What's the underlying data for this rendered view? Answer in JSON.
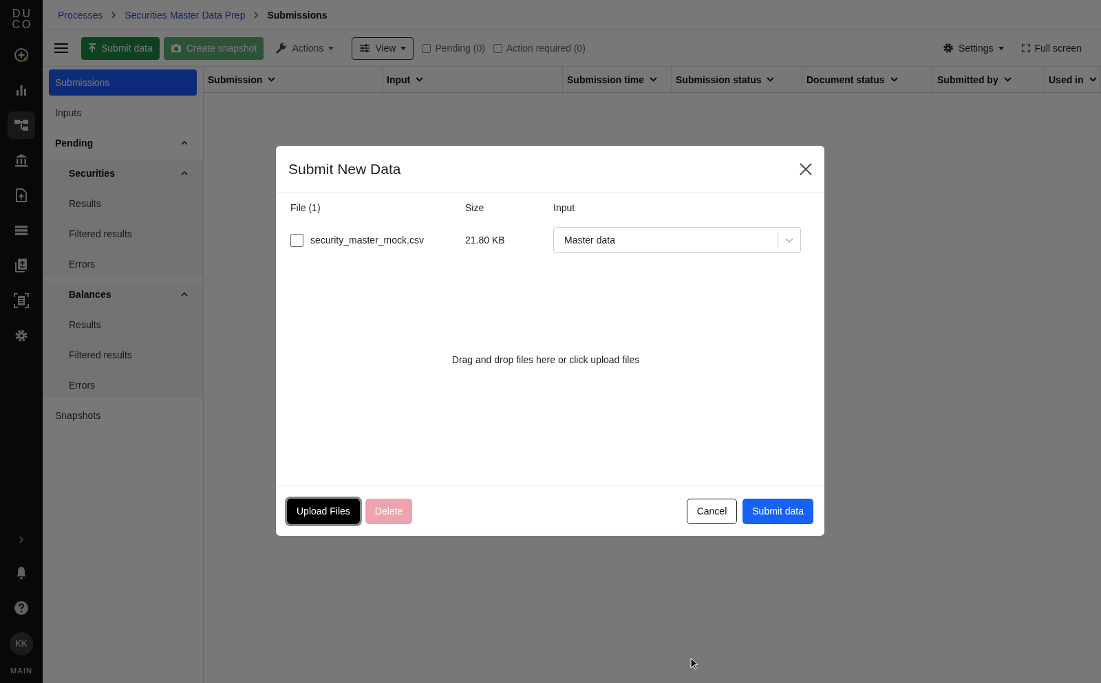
{
  "rail": {
    "logo": [
      "DU",
      "CO"
    ],
    "items": [
      {
        "kind": "sparkle",
        "selected": false
      },
      {
        "kind": "chart",
        "selected": false
      },
      {
        "kind": "hierarchy",
        "selected": true
      },
      {
        "kind": "bank",
        "selected": false
      },
      {
        "kind": "upload",
        "selected": false
      },
      {
        "kind": "list",
        "selected": false
      },
      {
        "kind": "docadd",
        "selected": false
      },
      {
        "kind": "scan",
        "selected": false
      },
      {
        "kind": "gear",
        "selected": false
      }
    ],
    "bottom": {
      "expand": "›",
      "avatar": "KK",
      "workspace": "MAIN"
    }
  },
  "breadcrumb": [
    {
      "label": "Processes",
      "current": false
    },
    {
      "label": "Securities Master Data Prep",
      "current": false
    },
    {
      "label": "Submissions",
      "current": true
    }
  ],
  "toolbar": {
    "buttons": [
      {
        "kind": "primary",
        "label": "Submit data",
        "disabled": false
      },
      {
        "kind": "snapshot",
        "label": "Create snapshot",
        "disabled": true
      },
      {
        "kind": "actions",
        "label": "Actions",
        "disabled": false
      },
      {
        "kind": "view",
        "label": "View",
        "disabled": false
      }
    ],
    "filters": [
      {
        "label": "Pending (0)",
        "checked": false
      },
      {
        "label": "Action required (0)",
        "checked": false
      }
    ],
    "settings": "Settings",
    "fullscreen": "Full screen"
  },
  "sidebar": {
    "items": [
      {
        "label": "Submissions",
        "selected": true
      },
      {
        "label": "Inputs",
        "selected": false
      },
      {
        "label": "Pending",
        "selected": false,
        "expanded": true,
        "children": [
          {
            "label": "Securities",
            "selected": false,
            "expanded": true,
            "children": [
              {
                "label": "Results",
                "selected": false
              },
              {
                "label": "Filtered results",
                "selected": false
              },
              {
                "label": "Errors",
                "selected": false
              }
            ]
          },
          {
            "label": "Balances",
            "selected": false,
            "expanded": true,
            "children": [
              {
                "label": "Results",
                "selected": false
              },
              {
                "label": "Filtered results",
                "selected": false
              },
              {
                "label": "Errors",
                "selected": false
              }
            ]
          }
        ]
      },
      {
        "label": "Snapshots",
        "selected": false
      }
    ]
  },
  "table": {
    "columns": [
      "Submission",
      "Input",
      "Submission time",
      "Submission status",
      "Document status",
      "Submitted by",
      "Used in"
    ]
  },
  "dialog": {
    "title": "Submit New Data",
    "columns": [
      "File (1)",
      "Size",
      "Input"
    ],
    "files": [
      {
        "name": "security_master_mock.csv",
        "size": "21.80 KB",
        "input": "Master data",
        "checked": false
      }
    ],
    "dropzone": "Drag and drop files here or click upload files",
    "buttons": [
      {
        "kind": "upload",
        "label": "Upload Files",
        "disabled": false
      },
      {
        "kind": "delete",
        "label": "Delete",
        "disabled": true
      },
      {
        "kind": "cancel",
        "label": "Cancel",
        "disabled": false
      },
      {
        "kind": "submit",
        "label": "Submit data",
        "disabled": false
      }
    ]
  }
}
